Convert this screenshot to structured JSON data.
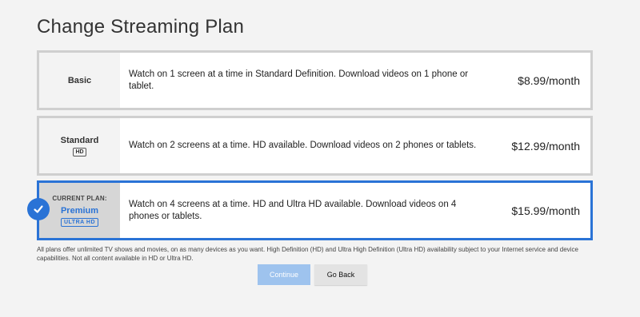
{
  "title": "Change Streaming Plan",
  "plans": [
    {
      "name": "Basic",
      "description": "Watch on 1 screen at a time in Standard Definition. Download videos on 1 phone or tablet.",
      "price": "$8.99/month"
    },
    {
      "name": "Standard",
      "badge": "HD",
      "description": "Watch on 2 screens at a time. HD available. Download videos on 2 phones or tablets.",
      "price": "$12.99/month"
    },
    {
      "current_label": "CURRENT PLAN:",
      "name": "Premium",
      "badge": "ULTRA HD",
      "description": "Watch on 4 screens at a time. HD and Ultra HD available. Download videos on 4 phones or tablets.",
      "price": "$15.99/month"
    }
  ],
  "fineprint": "All plans offer unlimited TV shows and movies, on as many devices as you want. High Definition (HD) and Ultra High Definition (Ultra HD) availability subject to your Internet service and device capabilities. Not all content available in HD or Ultra HD.",
  "buttons": {
    "continue": "Continue",
    "go_back": "Go Back"
  },
  "icons": {
    "selected": "checkmark-icon"
  },
  "colors": {
    "accent": "#2a73d6",
    "continue_disabled": "#9ec3ee"
  }
}
